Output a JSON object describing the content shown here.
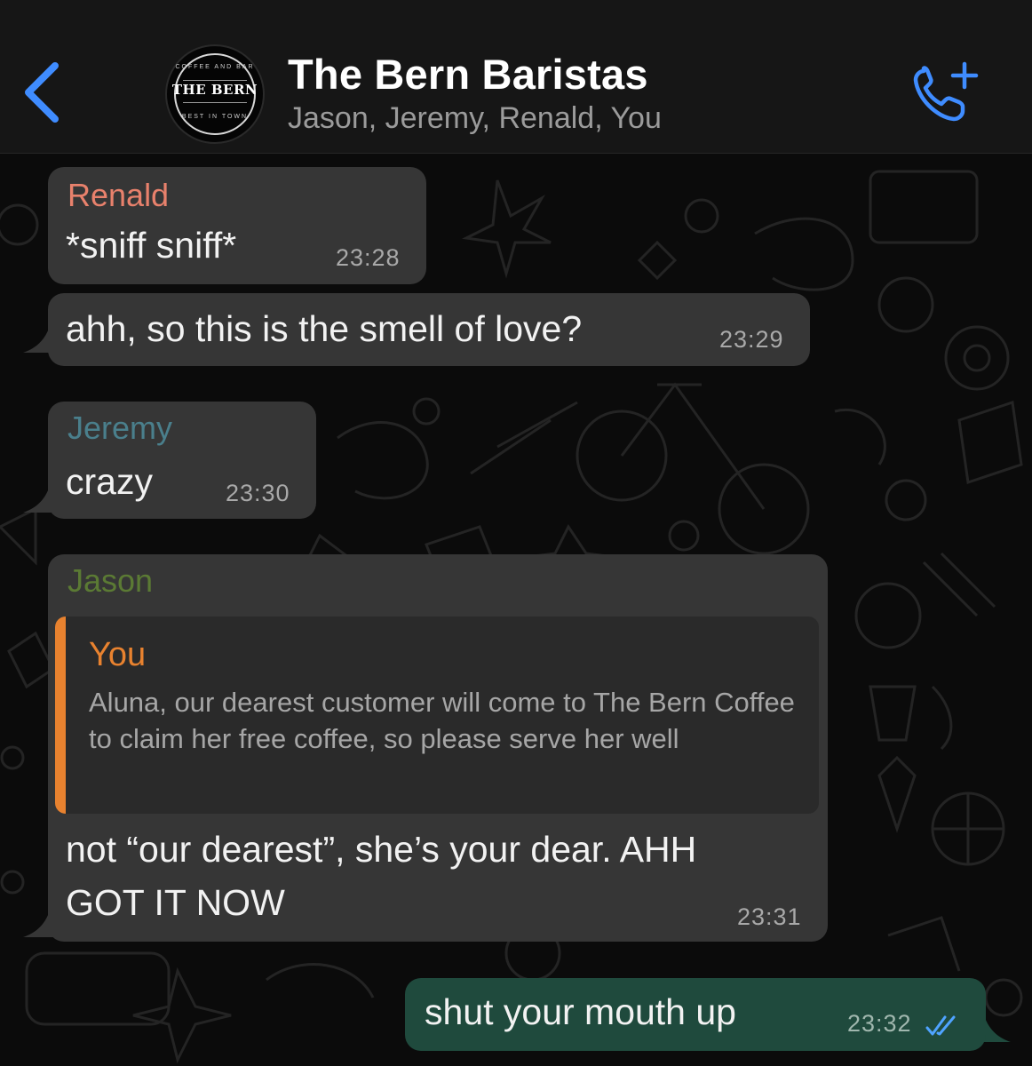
{
  "header": {
    "back_icon": "chevron-left-icon",
    "avatar": {
      "name": "THE BERN",
      "top_text": "COFFEE AND BAR",
      "bottom_text": "BEST IN TOWN"
    },
    "title": "The Bern Baristas",
    "members": "Jason, Jeremy, Renald, You",
    "call_icon": "add-call-icon"
  },
  "colors": {
    "accent_blue": "#3f8cff",
    "renald": "#e8816c",
    "jeremy": "#4a7f8c",
    "jason": "#5b7a34",
    "you_quote": "#e8822f",
    "outgoing_bubble": "#1f4a3d",
    "incoming_bubble": "#363636"
  },
  "messages": [
    {
      "sender": "Renald",
      "text": "*sniff sniff*",
      "time": "23:28"
    },
    {
      "text": "ahh, so this is the smell of love?",
      "time": "23:29"
    },
    {
      "sender": "Jeremy",
      "text": "crazy",
      "time": "23:30"
    },
    {
      "sender": "Jason",
      "quote": {
        "sender": "You",
        "text": "Aluna, our dearest customer will come to The Bern Coffee to claim her free coffee, so please serve her well"
      },
      "text_line1": "not “our dearest”, she’s your dear. AHH",
      "text_line2": "GOT IT NOW",
      "time": "23:31"
    },
    {
      "text": "shut your mouth up",
      "time": "23:32",
      "status_icon": "double-check-icon"
    }
  ]
}
